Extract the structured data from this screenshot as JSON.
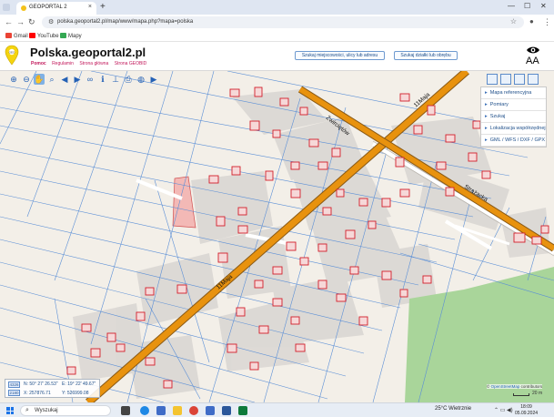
{
  "browser": {
    "tab_title": "GEOPORTAL 2",
    "tab_close": "×",
    "new_tab": "+",
    "url": "polska.geoportal2.pl/map/www/mapa.php?mapa=polska",
    "window_controls": [
      "—",
      "☐",
      "✕"
    ],
    "bookmarks": [
      {
        "label": "Gmail",
        "color": "#ea4335"
      },
      {
        "label": "YouTube",
        "color": "#ff0000"
      },
      {
        "label": "Mapy",
        "color": "#34a853"
      }
    ]
  },
  "header": {
    "site_title": "Polska.geoportal2.pl",
    "links": [
      "Pomoc",
      "Regulamin",
      "Strona główna",
      "Strona GEOBID"
    ],
    "search_address_button": "Szukaj miejscowości, ulicy lub adresu",
    "search_parcel_button": "Szukaj działki lub obrębu",
    "font_size_label": "AA"
  },
  "map": {
    "side_panel": [
      "Mapa referencyjna",
      "Pomiary",
      "Szukaj",
      "Lokalizacja współrzędnej",
      "GML / WFS / DXF / GPX"
    ],
    "street_labels": [
      "Żwirciętów",
      "11Maja",
      "Strażacka",
      "11Maja"
    ],
    "coordinates": {
      "epsg_top": "4326",
      "epsg_bottom": "2180",
      "lat": "N: 50° 27' 26.53\"",
      "lon": "E: 19° 22' 49.67\"",
      "x": "X: 257876.71",
      "y": "Y: 526999.08"
    },
    "attribution_prefix": "©",
    "attribution_link": "OpenStreetMap",
    "attribution_suffix": "contributors",
    "scale_label": "20 m",
    "colors": {
      "background": "#f3efe8",
      "main_road": "#e8920e",
      "road_casing": "#8a5a16",
      "parcel_line": "#5b8fd6",
      "building": "#d21f2b",
      "block": "#d9d6d2",
      "forest": "#a9d59a",
      "highlight_parcel": "#f3b9b6"
    }
  },
  "taskbar": {
    "search_placeholder": "Wyszukaj",
    "weather": "25°C  Wietrznie",
    "time": "18:09",
    "date": "05.09.2024"
  }
}
